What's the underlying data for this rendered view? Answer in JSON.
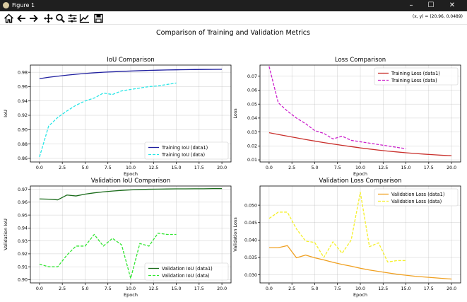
{
  "window": {
    "title": "Figure 1",
    "controls": {
      "minimize": "–",
      "maximize": "☐",
      "close": "✕"
    }
  },
  "toolbar": {
    "buttons": [
      "home-icon",
      "back-icon",
      "forward-icon",
      "pan-icon",
      "zoom-icon",
      "configure-subplots-icon",
      "edit-axis-icon",
      "save-icon"
    ],
    "coordinate_readout": "(x, y) = (20.96, 0.0489)"
  },
  "figure": {
    "suptitle": "Comparison of Training and Validation Metrics"
  },
  "chart_data": [
    {
      "type": "line",
      "title": "IoU Comparison",
      "xlabel": "Epoch",
      "ylabel": "IoU",
      "xlim": [
        -1,
        21
      ],
      "ylim": [
        0.855,
        0.99
      ],
      "xticks": [
        0.0,
        2.5,
        5.0,
        7.5,
        10.0,
        12.5,
        15.0,
        17.5,
        20.0
      ],
      "yticks": [
        0.86,
        0.88,
        0.9,
        0.92,
        0.94,
        0.96,
        0.98
      ],
      "ytick_decimals": 2,
      "grid": true,
      "legend": "lower-right",
      "series": [
        {
          "name": "Training IoU (data1)",
          "style": "solid",
          "color": "#1f1f9f",
          "x": [
            0,
            1,
            2,
            3,
            4,
            5,
            6,
            7,
            8,
            9,
            10,
            11,
            12,
            13,
            14,
            15,
            16,
            17,
            18,
            19,
            20
          ],
          "y": [
            0.971,
            0.973,
            0.9745,
            0.976,
            0.9772,
            0.9783,
            0.9792,
            0.98,
            0.9806,
            0.9812,
            0.9817,
            0.9822,
            0.9826,
            0.9829,
            0.9832,
            0.9834,
            0.9836,
            0.9838,
            0.9839,
            0.984,
            0.9841
          ]
        },
        {
          "name": "Training IoU (data)",
          "style": "dashed",
          "color": "#28e6e6",
          "x": [
            0,
            1,
            2,
            3,
            4,
            5,
            6,
            7,
            8,
            9,
            10,
            11,
            12,
            13,
            14,
            15
          ],
          "y": [
            0.862,
            0.905,
            0.917,
            0.926,
            0.934,
            0.94,
            0.944,
            0.951,
            0.949,
            0.954,
            0.956,
            0.958,
            0.96,
            0.961,
            0.963,
            0.965
          ]
        }
      ]
    },
    {
      "type": "line",
      "title": "Loss Comparison",
      "xlabel": "Epoch",
      "ylabel": "Loss",
      "xlim": [
        -1,
        21
      ],
      "ylim": [
        0.0085,
        0.078
      ],
      "xticks": [
        0.0,
        2.5,
        5.0,
        7.5,
        10.0,
        12.5,
        15.0,
        17.5,
        20.0
      ],
      "yticks": [
        0.01,
        0.02,
        0.03,
        0.04,
        0.05,
        0.06,
        0.07
      ],
      "ytick_decimals": 2,
      "grid": true,
      "legend": "upper-right",
      "series": [
        {
          "name": "Training Loss (data1)",
          "style": "solid",
          "color": "#c9302c",
          "x": [
            0,
            1,
            2,
            3,
            4,
            5,
            6,
            7,
            8,
            9,
            10,
            11,
            12,
            13,
            14,
            15,
            16,
            17,
            18,
            19,
            20
          ],
          "y": [
            0.0295,
            0.0282,
            0.027,
            0.0258,
            0.0246,
            0.0235,
            0.0224,
            0.0214,
            0.0204,
            0.0195,
            0.0186,
            0.0178,
            0.017,
            0.0163,
            0.0157,
            0.0151,
            0.0146,
            0.0141,
            0.0137,
            0.0133,
            0.013
          ]
        },
        {
          "name": "Training Loss (data)",
          "style": "dashed",
          "color": "#cc22cc",
          "x": [
            0,
            1,
            2,
            3,
            4,
            5,
            6,
            7,
            8,
            9,
            10,
            11,
            12,
            13,
            14,
            15
          ],
          "y": [
            0.077,
            0.051,
            0.045,
            0.04,
            0.036,
            0.031,
            0.029,
            0.025,
            0.027,
            0.024,
            0.023,
            0.022,
            0.021,
            0.02,
            0.019,
            0.018
          ]
        }
      ]
    },
    {
      "type": "line",
      "title": "Validation IoU Comparison",
      "xlabel": "Epoch",
      "ylabel": "Validation IoU",
      "xlim": [
        -1,
        21
      ],
      "ylim": [
        0.8975,
        0.9725
      ],
      "xticks": [
        0.0,
        2.5,
        5.0,
        7.5,
        10.0,
        12.5,
        15.0,
        17.5,
        20.0
      ],
      "yticks": [
        0.9,
        0.91,
        0.92,
        0.93,
        0.94,
        0.95,
        0.96,
        0.97
      ],
      "ytick_decimals": 2,
      "grid": true,
      "legend": "lower-right",
      "series": [
        {
          "name": "Validation IoU (data1)",
          "style": "solid",
          "color": "#1a6b1a",
          "x": [
            0,
            1,
            2,
            3,
            4,
            5,
            6,
            7,
            8,
            9,
            10,
            11,
            12,
            13,
            14,
            15,
            16,
            17,
            18,
            19,
            20
          ],
          "y": [
            0.9625,
            0.9623,
            0.9618,
            0.9655,
            0.9648,
            0.9662,
            0.9672,
            0.968,
            0.9686,
            0.9691,
            0.9695,
            0.9698,
            0.97,
            0.9701,
            0.9702,
            0.9703,
            0.9703,
            0.9704,
            0.9704,
            0.9705,
            0.9705
          ]
        },
        {
          "name": "Validation IoU (data)",
          "style": "dashed",
          "color": "#33e633",
          "x": [
            0,
            1,
            2,
            3,
            4,
            5,
            6,
            7,
            8,
            9,
            10,
            11,
            12,
            13,
            14,
            15
          ],
          "y": [
            0.912,
            0.91,
            0.91,
            0.919,
            0.926,
            0.926,
            0.935,
            0.926,
            0.932,
            0.927,
            0.901,
            0.928,
            0.926,
            0.936,
            0.935,
            0.935
          ]
        }
      ]
    },
    {
      "type": "line",
      "title": "Validation Loss Comparison",
      "xlabel": "Epoch",
      "ylabel": "Validation Loss",
      "xlim": [
        -1,
        21
      ],
      "ylim": [
        0.0277,
        0.0555
      ],
      "xticks": [
        0.0,
        2.5,
        5.0,
        7.5,
        10.0,
        12.5,
        15.0,
        17.5,
        20.0
      ],
      "yticks": [
        0.03,
        0.035,
        0.04,
        0.045,
        0.05
      ],
      "ytick_decimals": 3,
      "grid": true,
      "legend": "upper-right",
      "series": [
        {
          "name": "Validation Loss (data1)",
          "style": "solid",
          "color": "#f0a020",
          "x": [
            0,
            1,
            2,
            3,
            4,
            5,
            6,
            7,
            8,
            9,
            10,
            11,
            12,
            13,
            14,
            15,
            16,
            17,
            18,
            19,
            20
          ],
          "y": [
            0.0378,
            0.0378,
            0.0384,
            0.0349,
            0.0357,
            0.0349,
            0.0343,
            0.0336,
            0.033,
            0.0325,
            0.0319,
            0.0314,
            0.031,
            0.0306,
            0.0302,
            0.0299,
            0.0296,
            0.0294,
            0.0292,
            0.029,
            0.0288
          ]
        },
        {
          "name": "Validation Loss (data)",
          "style": "dashed",
          "color": "#f5f02a",
          "x": [
            0,
            1,
            2,
            3,
            4,
            5,
            6,
            7,
            8,
            9,
            10,
            11,
            12,
            13,
            14,
            15
          ],
          "y": [
            0.0462,
            0.048,
            0.048,
            0.0432,
            0.0397,
            0.0393,
            0.035,
            0.0395,
            0.0362,
            0.04,
            0.0537,
            0.0381,
            0.0392,
            0.0337,
            0.0341,
            0.0341
          ]
        }
      ]
    }
  ]
}
